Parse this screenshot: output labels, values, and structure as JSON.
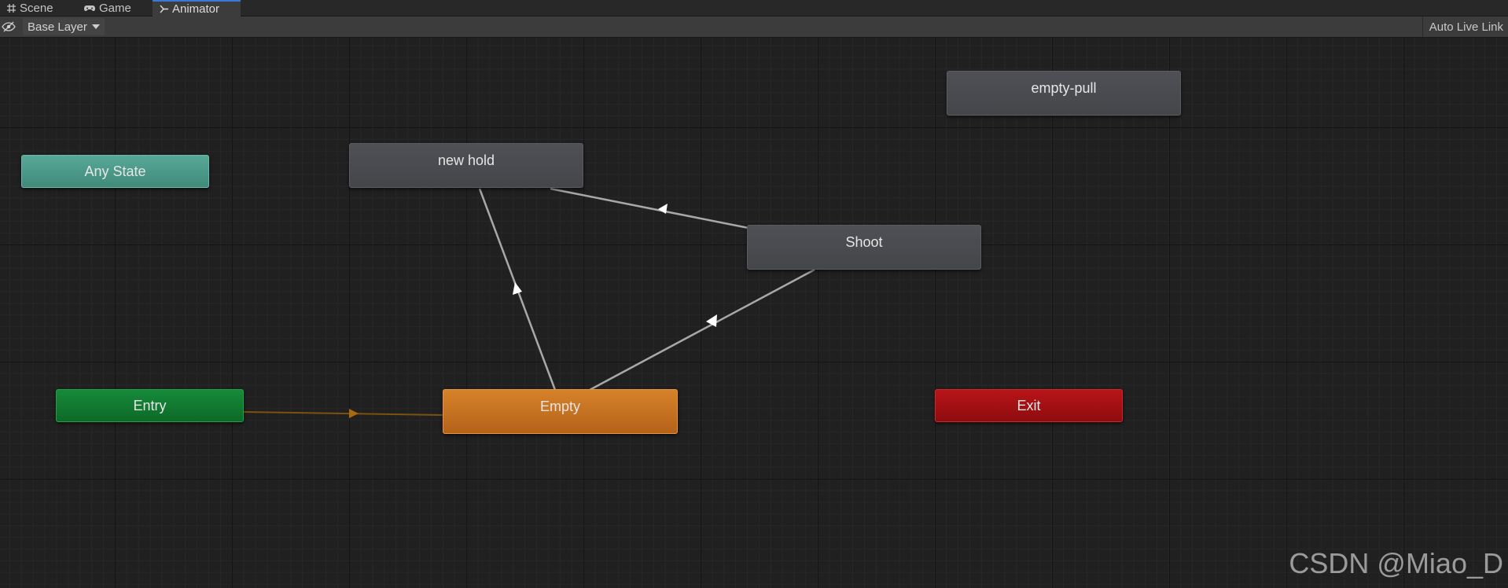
{
  "tabs": [
    {
      "label": "Scene",
      "icon": "grid-icon"
    },
    {
      "label": "Game",
      "icon": "gamepad-icon"
    },
    {
      "label": "Animator",
      "icon": "animator-icon",
      "active": true
    }
  ],
  "toolbar": {
    "eye_icon": "eye-slash-icon",
    "layer": "Base Layer",
    "live_link": "Auto Live Link"
  },
  "graph": {
    "states": {
      "any_state": "Any State",
      "entry": "Entry",
      "exit": "Exit",
      "empty": "Empty",
      "new_hold": "new hold",
      "shoot": "Shoot",
      "empty_pull": "empty-pull"
    },
    "transitions": [
      {
        "from": "Entry",
        "to": "Empty",
        "default": true
      },
      {
        "from": "Empty",
        "to": "new hold"
      },
      {
        "from": "Shoot",
        "to": "new hold"
      },
      {
        "from": "Empty",
        "to": "Shoot"
      }
    ]
  },
  "colors": {
    "any_state": "#4f9a8b",
    "entry": "#127c33",
    "exit": "#a81115",
    "default_state": "#c97322",
    "state": "#4a4c50",
    "default_transition": "#a86a0e",
    "transition": "#a8a8a8",
    "active_tab_accent": "#3a78d8"
  },
  "watermark": "CSDN @Miao_D"
}
